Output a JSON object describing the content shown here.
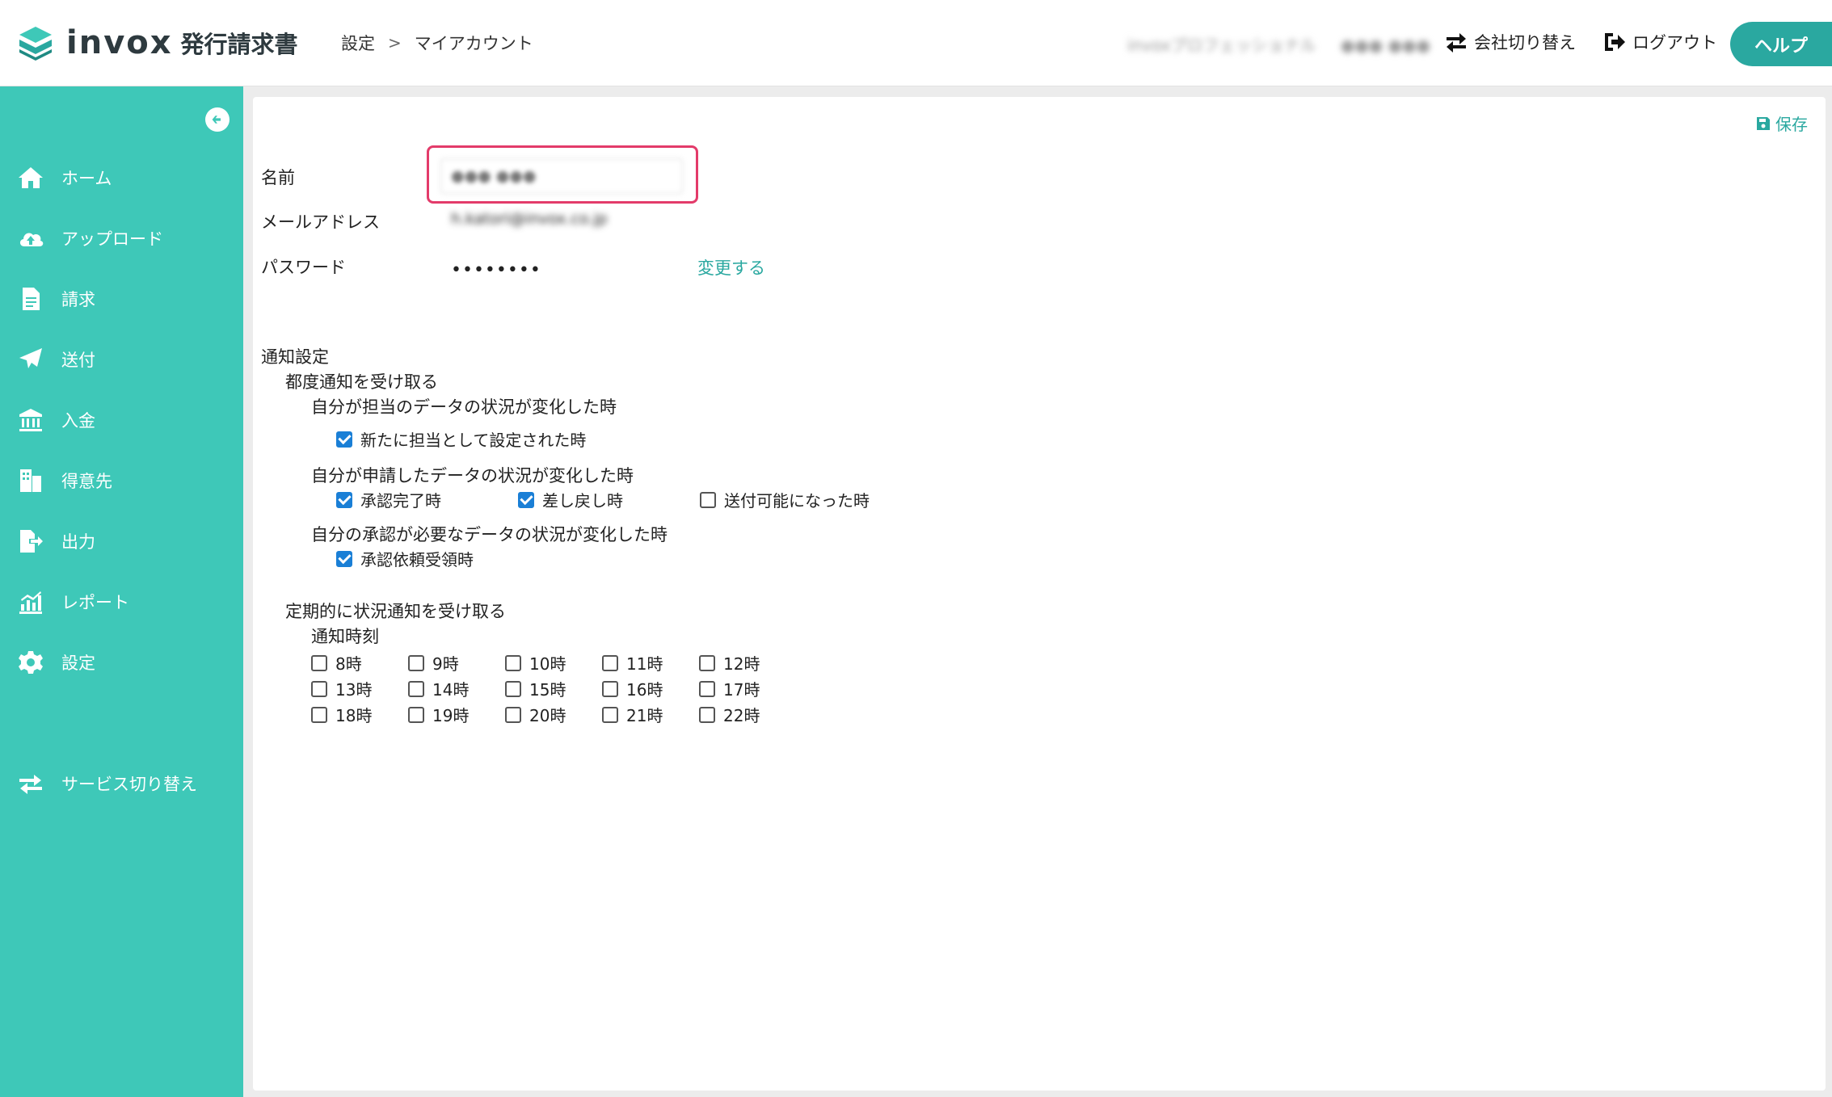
{
  "header": {
    "brand": "invox",
    "product": "発行請求書",
    "breadcrumb": [
      "設定",
      "マイアカウント"
    ],
    "user_company": "invoxプロフェッショナル",
    "user_name": "●●● ●●●",
    "switch_company_label": "会社切り替え",
    "logout_label": "ログアウト",
    "help_label": "ヘルプ"
  },
  "sidebar": {
    "items": [
      {
        "label": "ホーム",
        "icon": "home-icon"
      },
      {
        "label": "アップロード",
        "icon": "cloud-upload-icon"
      },
      {
        "label": "請求",
        "icon": "document-icon"
      },
      {
        "label": "送付",
        "icon": "paper-plane-icon"
      },
      {
        "label": "入金",
        "icon": "bank-icon"
      },
      {
        "label": "得意先",
        "icon": "building-icon"
      },
      {
        "label": "出力",
        "icon": "file-export-icon"
      },
      {
        "label": "レポート",
        "icon": "chart-icon"
      },
      {
        "label": "設定",
        "icon": "gear-icon"
      }
    ],
    "service_switch_label": "サービス切り替え"
  },
  "form": {
    "save_label": "保存",
    "name_label": "名前",
    "name_value": "●●● ●●●",
    "email_label": "メールアドレス",
    "email_value": "h.katori@invox.co.jp",
    "password_label": "パスワード",
    "password_value": "••••••••",
    "change_label": "変更する"
  },
  "notifications": {
    "title": "通知設定",
    "instant_title": "都度通知を受け取る",
    "group1_title": "自分が担当のデータの状況が変化した時",
    "group1_options": [
      {
        "label": "新たに担当として設定された時",
        "checked": true
      }
    ],
    "group2_title": "自分が申請したデータの状況が変化した時",
    "group2_options": [
      {
        "label": "承認完了時",
        "checked": true
      },
      {
        "label": "差し戻し時",
        "checked": true
      },
      {
        "label": "送付可能になった時",
        "checked": false
      }
    ],
    "group3_title": "自分の承認が必要なデータの状況が変化した時",
    "group3_options": [
      {
        "label": "承認依頼受領時",
        "checked": true
      }
    ],
    "periodic_title": "定期的に状況通知を受け取る",
    "time_title": "通知時刻",
    "hours": [
      {
        "label": "8時",
        "checked": false
      },
      {
        "label": "9時",
        "checked": false
      },
      {
        "label": "10時",
        "checked": false
      },
      {
        "label": "11時",
        "checked": false
      },
      {
        "label": "12時",
        "checked": false
      },
      {
        "label": "13時",
        "checked": false
      },
      {
        "label": "14時",
        "checked": false
      },
      {
        "label": "15時",
        "checked": false
      },
      {
        "label": "16時",
        "checked": false
      },
      {
        "label": "17時",
        "checked": false
      },
      {
        "label": "18時",
        "checked": false
      },
      {
        "label": "19時",
        "checked": false
      },
      {
        "label": "20時",
        "checked": false
      },
      {
        "label": "21時",
        "checked": false
      },
      {
        "label": "22時",
        "checked": false
      }
    ]
  },
  "colors": {
    "accent": "#2aa8a0",
    "sidebar": "#3ec8b8",
    "highlight": "#e33b6a",
    "checkbox": "#1a7fd6"
  }
}
